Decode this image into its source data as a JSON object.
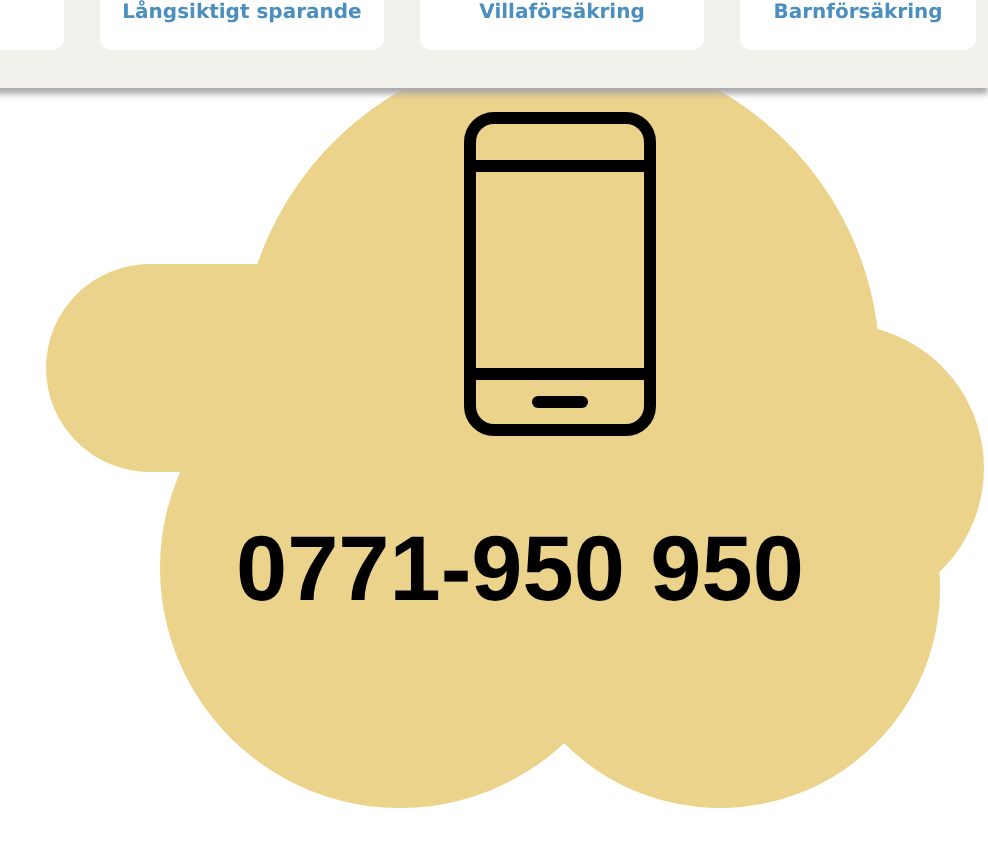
{
  "nav_cards": [
    {
      "label": "Långsiktigt sparande"
    },
    {
      "label": "Villaförsäkring"
    },
    {
      "label": "Barnförsäkring"
    }
  ],
  "contact": {
    "phone": "0771-950 950"
  }
}
